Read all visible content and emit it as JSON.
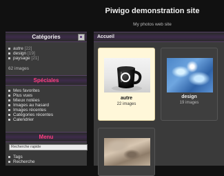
{
  "header": {
    "title": "Piwigo demonstration site",
    "subtitle": "My photos web site"
  },
  "sidebar": {
    "categories": {
      "title": "Catégories",
      "items": [
        {
          "label": "autre",
          "count": "[22]"
        },
        {
          "label": "design",
          "count": "[19]"
        },
        {
          "label": "paysage",
          "count": "[21]"
        }
      ],
      "total": "62 images"
    },
    "specials": {
      "title": "Spéciales",
      "items": [
        "Mes favorites",
        "Plus vues",
        "Mieux notées",
        "Images au hasard",
        "Images récentes",
        "Catégories récentes",
        "Calendrier"
      ]
    },
    "menu": {
      "title": "Menu",
      "search_placeholder": "Recherche rapide",
      "items": [
        "Tags",
        "Recherche"
      ]
    }
  },
  "main": {
    "breadcrumb": "Accueil",
    "thumbnails": [
      {
        "name": "autre",
        "count": "22 images",
        "icon": "mug-photo"
      },
      {
        "name": "design",
        "count": "19 images",
        "icon": "water-photo"
      },
      {
        "name": "",
        "count": "",
        "icon": "sand-photo"
      }
    ]
  },
  "colors": {
    "accent": "#ff3f7f",
    "panel_bg": "#3a3a3a",
    "page_bg": "#111111",
    "active_card": "#fff7d9"
  }
}
